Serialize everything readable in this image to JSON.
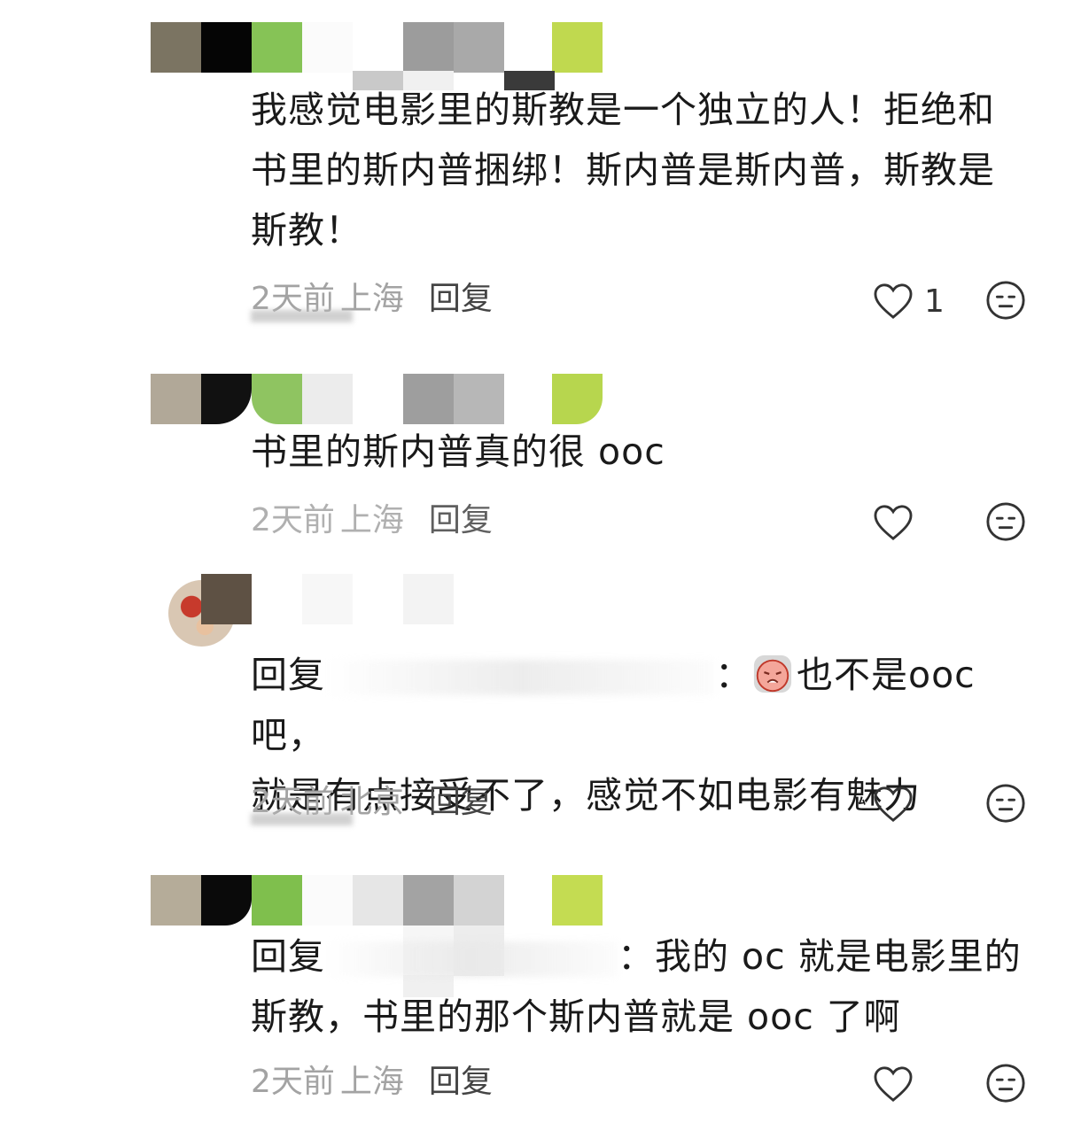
{
  "comments": [
    {
      "text": "我感觉电影里的斯教是一个独立的人！拒绝和书里的斯内普捆绑！斯内普是斯内普，斯教是斯教！",
      "time": "2天前",
      "location": "上海",
      "reply_label": "回复",
      "likes": "1"
    },
    {
      "text": "书里的斯内普真的很 ooc",
      "time": "2天前",
      "location": "上海",
      "reply_label": "回复",
      "likes": ""
    },
    {
      "reply_prefix": "回复",
      "reply_colon": "：",
      "text_line1": "也不是ooc吧，",
      "text_line2": "就是有点接受不了，感觉不如电影有魅力",
      "time": "2天前",
      "location": "北京",
      "reply_label": "回复",
      "likes": ""
    },
    {
      "reply_prefix": "回复",
      "reply_colon": "：",
      "text_line1": "我的 oc 就是电影里的",
      "text_line2": "斯教，书里的那个斯内普就是 ooc 了啊",
      "time": "2天前",
      "location": "上海",
      "reply_label": "回复",
      "likes": ""
    }
  ],
  "colors": {
    "text": "#1a1a1a",
    "meta": "#a3a3a3",
    "icon": "#333333"
  },
  "icons": [
    "heart-icon",
    "emoji-face-icon"
  ]
}
